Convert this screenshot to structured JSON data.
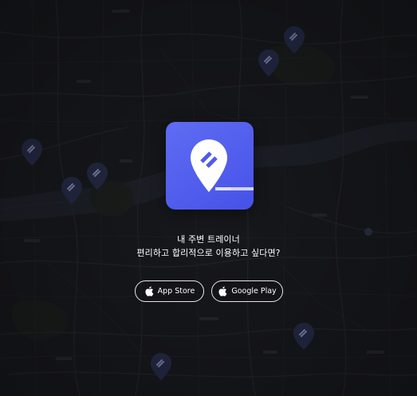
{
  "hero": {
    "line1": "내 주변 트레이너",
    "line2": "편리하고 합리적으로 이용하고 싶다면?"
  },
  "buttons": {
    "app_store": "App Store",
    "google_play": "Google Play"
  },
  "icons": {
    "app_logo": "map-pin-tool-icon",
    "apple": "apple-icon",
    "map_marker": "map-marker-icon"
  },
  "colors": {
    "background": "#17181c",
    "brand": "#5560ee",
    "marker": "#2a2f52",
    "text": "#ffffff",
    "button_border": "#e6e6e6"
  }
}
